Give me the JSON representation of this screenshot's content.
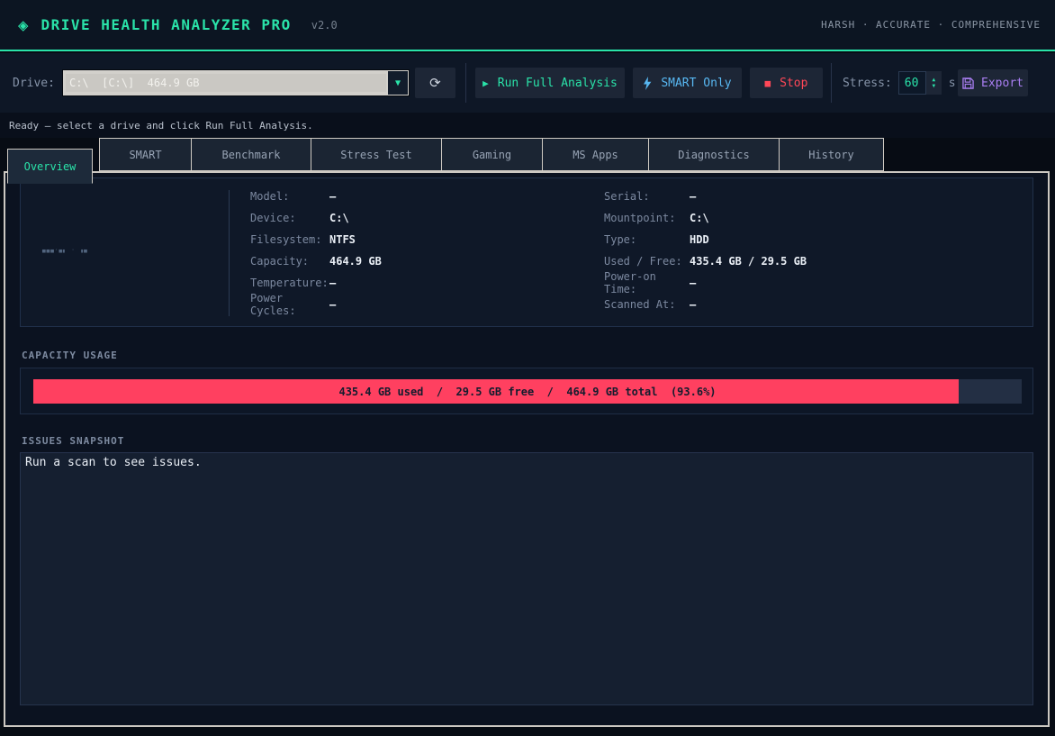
{
  "colors": {
    "accent": "#2ae3a9",
    "blue": "#58b8f2",
    "red": "#ff4757",
    "bar_red": "#ff4060",
    "purple": "#a97ef2"
  },
  "header": {
    "logo_icon": "◈",
    "title": "DRIVE HEALTH ANALYZER PRO",
    "version": "v2.0",
    "tagline": "HARSH  ·  ACCURATE  ·  COMPREHENSIVE"
  },
  "toolbar": {
    "drive_label": "Drive:",
    "drive_value": "C:\\  [C:\\]  464.9 GB",
    "combo_arrow": "▼",
    "refresh_icon": "⟳",
    "run_icon": "▶",
    "run_label": "Run Full Analysis",
    "smart_label": "SMART Only",
    "stop_icon": "■",
    "stop_label": "Stop",
    "stress_label": "Stress:",
    "stress_value": "60",
    "spin_up": "▲",
    "spin_down": "▼",
    "stress_unit": "s",
    "export_label": "Export"
  },
  "statusbar": {
    "text": "Ready — select a drive and click Run Full Analysis."
  },
  "tabs": [
    "Overview",
    "SMART",
    "Benchmark",
    "Stress Test",
    "Gaming",
    "MS Apps",
    "Diagnostics",
    "History"
  ],
  "overview": {
    "drive_art": "▄▄▄·▄▖ · ▗▄",
    "info_left": [
      {
        "label": "Model:",
        "value": "—"
      },
      {
        "label": "Device:",
        "value": "C:\\"
      },
      {
        "label": "Filesystem:",
        "value": "NTFS"
      },
      {
        "label": "Capacity:",
        "value": "464.9 GB"
      },
      {
        "label": "Temperature:",
        "value": "—"
      },
      {
        "label": "Power Cycles:",
        "value": "—"
      }
    ],
    "info_right": [
      {
        "label": "Serial:",
        "value": "—"
      },
      {
        "label": "Mountpoint:",
        "value": "C:\\"
      },
      {
        "label": "Type:",
        "value": "HDD"
      },
      {
        "label": "Used / Free:",
        "value": "435.4 GB / 29.5 GB"
      },
      {
        "label": "Power-on Time:",
        "value": "—"
      },
      {
        "label": "Scanned At:",
        "value": "—"
      }
    ],
    "capacity": {
      "section_title": "CAPACITY USAGE",
      "bar_text": "435.4 GB used  /  29.5 GB free  /  464.9 GB total  (93.6%)",
      "used_pct": 93.6
    },
    "issues": {
      "section_title": "ISSUES SNAPSHOT",
      "text": "Run a scan to see issues."
    }
  }
}
